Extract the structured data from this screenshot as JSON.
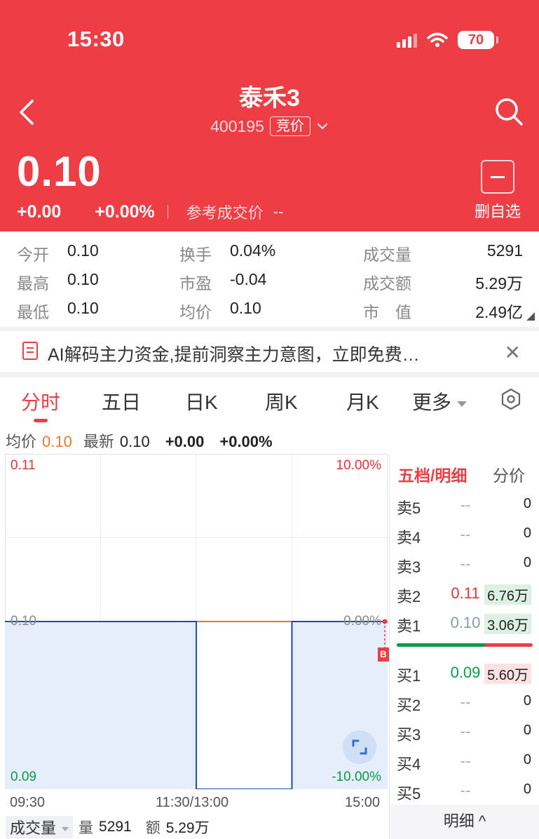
{
  "status_bar": {
    "time": "15:30",
    "battery": "70"
  },
  "header": {
    "title": "泰禾3",
    "code": "400195",
    "badge": "竞价",
    "price": "0.10",
    "change": "+0.00",
    "change_pct": "+0.00%",
    "ref_label": "参考成交价",
    "ref_value": "--",
    "remove_label": "删自选"
  },
  "stats": {
    "open_label": "今开",
    "open": "0.10",
    "high_label": "最高",
    "high": "0.10",
    "low_label": "最低",
    "low": "0.10",
    "turnover_label": "换手",
    "turnover": "0.04%",
    "pe_label": "市盈",
    "pe": "-0.04",
    "avg_label": "均价",
    "avg": "0.10",
    "volume_label": "成交量",
    "volume": "5291",
    "amount_label": "成交额",
    "amount": "5.29万",
    "mktcap_label": "市　值",
    "mktcap": "2.49亿"
  },
  "promo": {
    "text": "AI解码主力资金,提前洞察主力意图，立即免费…"
  },
  "tabs": [
    "分时",
    "五日",
    "日K",
    "周K",
    "月K",
    "更多"
  ],
  "info_row": {
    "avg_label": "均价",
    "avg": "0.10",
    "latest_label": "最新",
    "latest": "0.10",
    "change": "+0.00",
    "change_pct": "+0.00%"
  },
  "chart_data": {
    "type": "line",
    "y_left_labels": [
      "0.11",
      "0.10",
      "0.09"
    ],
    "y_right_labels": [
      "10.00%",
      "0.00%",
      "-10.00%"
    ],
    "x_labels": [
      "09:30",
      "11:30/13:00",
      "15:00"
    ],
    "ylim": [
      0.09,
      0.11
    ],
    "reference": 0.1,
    "series": [
      {
        "values": [
          0.1,
          0.1,
          0.09,
          0.09,
          0.1,
          0.1
        ],
        "x_fraction": [
          0,
          0.5,
          0.5,
          0.75,
          0.75,
          1
        ]
      }
    ],
    "colors": {
      "price_line": "#1f4fa8",
      "avg_line": "#e8792a",
      "fill": "#e6eefb"
    }
  },
  "volume": {
    "tag": "成交量",
    "vol_label": "量",
    "vol": "5291",
    "amt_label": "额",
    "amt": "5.29万"
  },
  "order_book": {
    "title": "五档/明细",
    "subtitle": "分价",
    "sells": [
      {
        "name": "卖5",
        "price": "--",
        "qty": "0"
      },
      {
        "name": "卖4",
        "price": "--",
        "qty": "0"
      },
      {
        "name": "卖3",
        "price": "--",
        "qty": "0"
      },
      {
        "name": "卖2",
        "price": "0.11",
        "qty": "6.76万"
      },
      {
        "name": "卖1",
        "price": "0.10",
        "qty": "3.06万"
      }
    ],
    "buys": [
      {
        "name": "买1",
        "price": "0.09",
        "qty": "5.60万"
      },
      {
        "name": "买2",
        "price": "--",
        "qty": "0"
      },
      {
        "name": "买3",
        "price": "--",
        "qty": "0"
      },
      {
        "name": "买4",
        "price": "--",
        "qty": "0"
      },
      {
        "name": "买5",
        "price": "--",
        "qty": "0"
      }
    ],
    "footer": "明细 ^",
    "buy_ratio": 0.65
  }
}
